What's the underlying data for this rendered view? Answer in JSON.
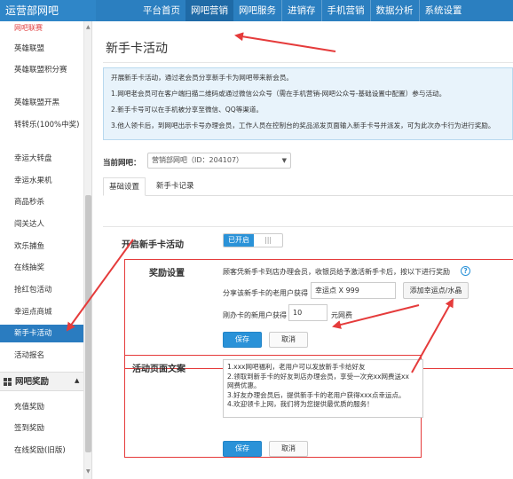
{
  "brand": "运营部网吧",
  "nav": [
    "平台首页",
    "网吧营销",
    "网吧服务",
    "进销存",
    "手机营销",
    "数据分析",
    "系统设置"
  ],
  "nav_active_index": 1,
  "sidebar": {
    "top_cut": "网吧联赛",
    "items": [
      "英雄联盟",
      "英雄联盟积分赛",
      "英雄联盟开黑",
      "转转乐(100%中奖)",
      "幸运大转盘",
      "幸运水果机",
      "商品秒杀",
      "闯关达人",
      "欢乐捕鱼",
      "在线抽奖",
      "抢红包活动",
      "幸运点商城",
      "新手卡活动",
      "活动报名"
    ],
    "active_item": "新手卡活动",
    "group_title": "网吧奖励",
    "group_items": [
      "充值奖励",
      "签到奖励",
      "在线奖励(旧版)"
    ]
  },
  "page_title": "新手卡活动",
  "info_lines": [
    "开展新手卡活动，通过老会员分享新手卡为网吧带来新会员。",
    "1.网吧老会员可在客户端扫描二维码或通过微信公众号（需在手机营销-网吧公众号-基础设置中配置）参与活动。",
    "2.新手卡号可以在手机被分享至微信、QQ等渠道。",
    "3.他人领卡后，到网吧出示卡号办理会员，工作人员在控制台的奖品派发页面输入新手卡号并派发，可为此次办卡行为进行奖励。"
  ],
  "current_netbar": {
    "label": "当前网吧：",
    "value": "营销部网吧（ID：204107）"
  },
  "tabs": [
    "基础设置",
    "新手卡记录"
  ],
  "toggle": {
    "label": "开启新手卡活动",
    "state": "已开启"
  },
  "reward": {
    "title": "奖励设置",
    "description": "顾客凭新手卡到店办理会员，收银员给予激活新手卡后，按以下进行奖励",
    "row1_label": "分享该新手卡的老用户获得",
    "row1_value": "幸运点 X 999",
    "add_button": "添加幸运点/水晶",
    "row2_label": "刚办卡的新用户获得",
    "row2_value": "10",
    "row2_unit": "元网费",
    "save": "保存",
    "cancel": "取消"
  },
  "copy": {
    "title": "活动页面文案",
    "lines": [
      "1.xxx网吧福利，老用户可以发放新手卡给好友",
      "2.领取到新手卡的好友到店办理会员，享受一次充xx网费送xx",
      "网费优惠。",
      "3.好友办理会员后，提供新手卡的老用户获得xxx点幸运点。",
      "4.欢迎领卡上网，我们将为您提供最优质的服务！"
    ],
    "save": "保存",
    "cancel": "取消"
  },
  "colors": {
    "topbar": "#2b7fc0",
    "active_nav": "#1f6aa6",
    "primary_button": "#2a92d8",
    "annotation": "#e53b3b"
  }
}
